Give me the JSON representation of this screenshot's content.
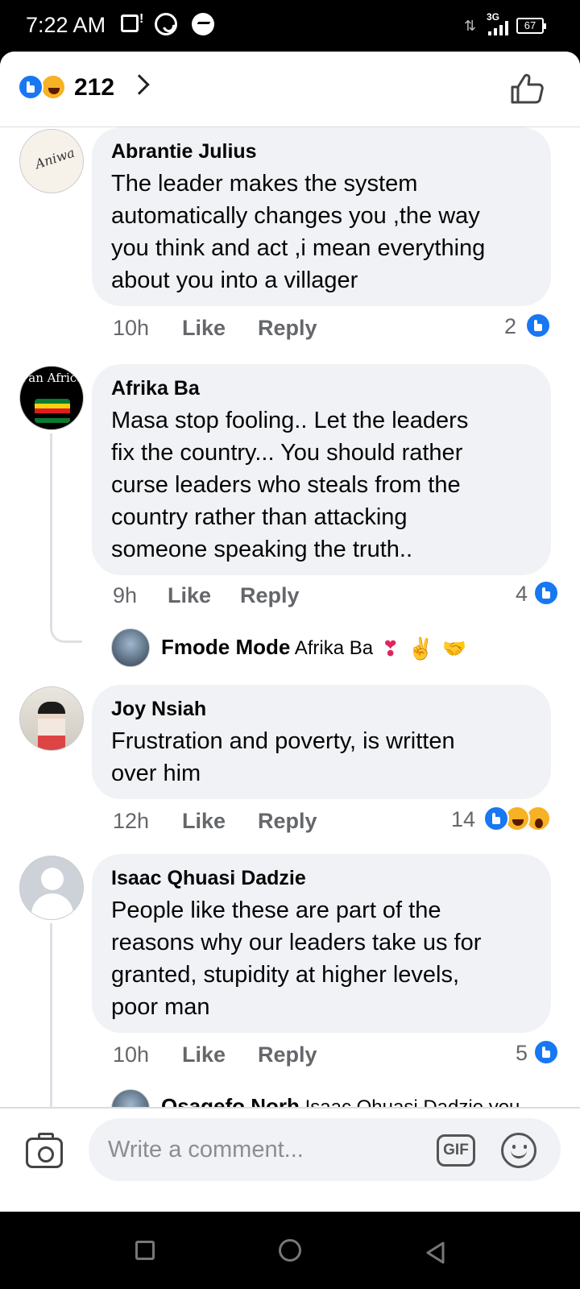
{
  "status_bar": {
    "time": "7:22 AM",
    "network": "3G",
    "battery": "67",
    "icons": [
      "gallery-icon",
      "whatsapp-icon",
      "messenger-icon",
      "data-arrows-icon",
      "signal-icon",
      "battery-icon"
    ]
  },
  "reactions": {
    "count": "212",
    "icons": [
      "like-reaction-icon",
      "haha-reaction-icon"
    ]
  },
  "comments": [
    {
      "author": "Abrantie Julius",
      "lines": [
        "The leader makes the system",
        "automatically changes you ,the way",
        "you think and act ,i mean everything",
        "about you  into a villager"
      ],
      "time": "10h",
      "like_label": "Like",
      "reply_label": "Reply",
      "reaction_count": "2"
    },
    {
      "author": "Afrika Ba",
      "avatar_text": "Pan Africa",
      "lines": [
        "Masa stop fooling.. Let the leaders",
        "fix the country... You should rather",
        "curse leaders who steals from the",
        "country rather than attacking",
        "someone speaking the truth.."
      ],
      "time": "9h",
      "like_label": "Like",
      "reply_label": "Reply",
      "reaction_count": "4",
      "reply": {
        "author": "Fmode Mode",
        "text": "Afrika Ba",
        "emojis": [
          "❣",
          "✌",
          "🤝"
        ]
      }
    },
    {
      "author": "Joy Nsiah",
      "lines": [
        "Frustration and poverty, is written",
        "over him"
      ],
      "time": "12h",
      "like_label": "Like",
      "reply_label": "Reply",
      "reaction_count": "14"
    },
    {
      "author": "Isaac Qhuasi Dadzie",
      "lines": [
        "People like these are  part of the",
        "reasons why our leaders take us for",
        "granted, stupidity at higher levels,",
        "poor man"
      ],
      "time": "10h",
      "like_label": "Like",
      "reply_label": "Reply",
      "reaction_count": "5",
      "reply": {
        "author": "Osagefo Norh",
        "text": "Isaac Qhuasi Dadzie you"
      }
    }
  ],
  "composer": {
    "placeholder": "Write a comment...",
    "gif_label": "GIF"
  },
  "colors": {
    "brand_blue": "#1877f2",
    "bubble_bg": "#f0f2f5",
    "meta_gray": "#65676b"
  }
}
